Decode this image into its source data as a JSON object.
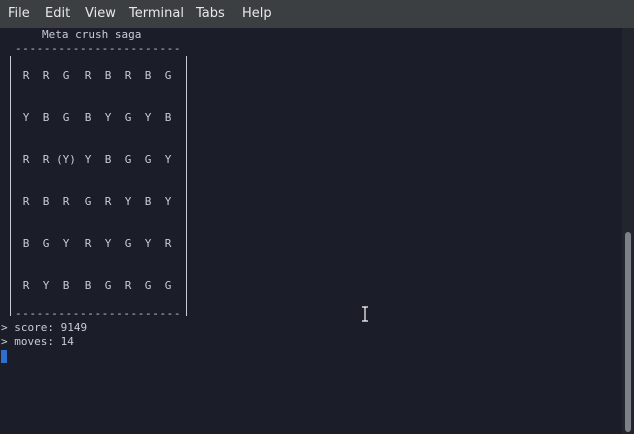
{
  "menubar": {
    "items": [
      "File",
      "Edit",
      "View",
      "Terminal",
      "Tabs",
      "Help"
    ]
  },
  "terminal": {
    "title": "Meta crush saga",
    "border_top": "-----------------------",
    "border_bottom": "-----------------------",
    "board": [
      [
        "R",
        "R",
        "G",
        "R",
        "B",
        "R",
        "B",
        "G"
      ],
      [
        "Y",
        "B",
        "G",
        "B",
        "Y",
        "G",
        "Y",
        "B"
      ],
      [
        "R",
        "R",
        "(Y)",
        "Y",
        "B",
        "G",
        "G",
        "Y"
      ],
      [
        "R",
        "B",
        "R",
        "G",
        "R",
        "Y",
        "B",
        "Y"
      ],
      [
        "B",
        "G",
        "Y",
        "R",
        "Y",
        "G",
        "Y",
        "R"
      ],
      [
        "R",
        "Y",
        "B",
        "B",
        "G",
        "R",
        "G",
        "G"
      ]
    ],
    "score_line": "> score: 9149",
    "moves_line": "> moves: 14"
  },
  "colors": {
    "menubar_bg": "#3c3f41",
    "terminal_bg": "#1b1e28",
    "text": "#c7ccd6",
    "cursor": "#2f6fce",
    "scrollbar_thumb": "#7d8088"
  },
  "icons": {
    "mouse_pointer": "ibeam-cursor-icon"
  }
}
